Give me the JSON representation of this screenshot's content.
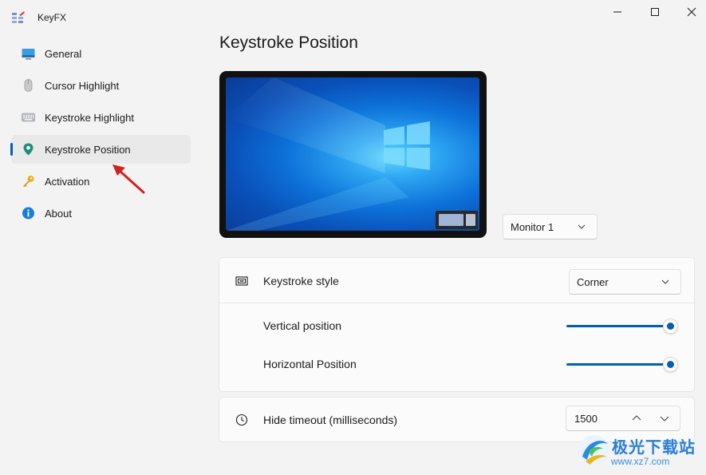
{
  "app": {
    "title": "KeyFX",
    "icon": "keyfx-logo-icon"
  },
  "window_controls": [
    {
      "name": "minimize",
      "icon": "minimize-icon"
    },
    {
      "name": "maximize",
      "icon": "maximize-icon"
    },
    {
      "name": "close",
      "icon": "close-icon"
    }
  ],
  "sidebar": {
    "items": [
      {
        "label": "General",
        "icon": "monitor-icon",
        "active": false
      },
      {
        "label": "Cursor Highlight",
        "icon": "mouse-icon",
        "active": false
      },
      {
        "label": "Keystroke Highlight",
        "icon": "keyboard-icon",
        "active": false
      },
      {
        "label": "Keystroke Position",
        "icon": "location-pin-icon",
        "active": true
      },
      {
        "label": "Activation",
        "icon": "key-icon",
        "active": false
      },
      {
        "label": "About",
        "icon": "info-icon",
        "active": false
      }
    ],
    "accent": "#005fb8"
  },
  "main": {
    "title": "Keystroke Position",
    "monitor_select": {
      "value": "Monitor 1"
    },
    "keystroke_style": {
      "label": "Keystroke style",
      "value": "Corner",
      "icon": "keyboard-frame-icon"
    },
    "vertical_position": {
      "label": "Vertical position",
      "level": 1.0
    },
    "horizontal_position": {
      "label": "Horizontal Position",
      "level": 1.0
    },
    "hide_timeout": {
      "label": "Hide timeout (milliseconds)",
      "value": "1500",
      "icon": "clock-icon"
    }
  },
  "watermark": {
    "line1": "极光下载站",
    "line2": "www.xz7.com"
  },
  "colors": {
    "accent": "#005fb8",
    "background": "#f3f3f3",
    "card": "#fbfbfb",
    "annotation_arrow": "#d42020"
  }
}
